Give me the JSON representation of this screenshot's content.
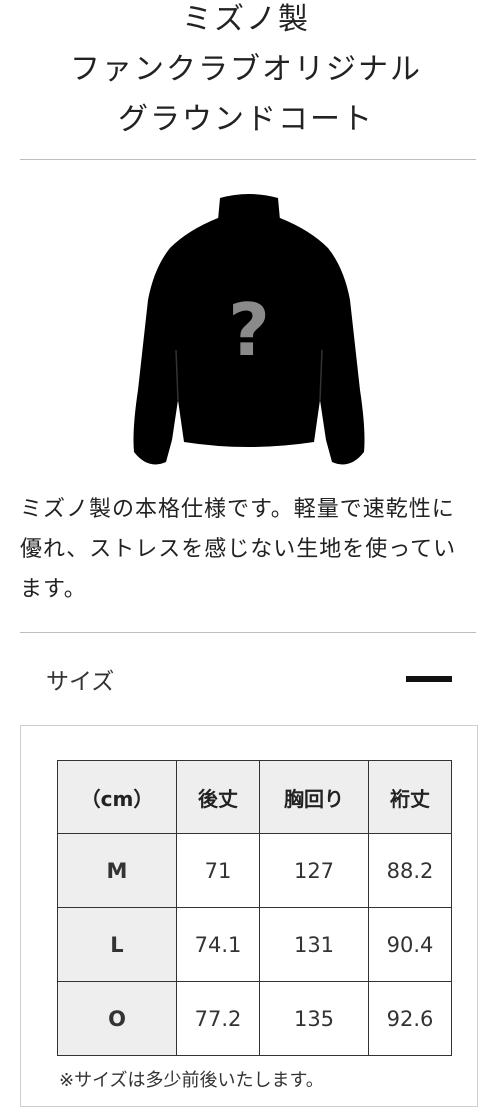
{
  "product": {
    "title_lines": [
      "ミズノ製",
      "ファンクラブオリジナル",
      "グラウンドコート"
    ],
    "image_placeholder": "?",
    "description": "ミズノ製の本格仕様です。軽量で速乾性に優れ、ストレスを感じない生地を使っています。"
  },
  "size_section": {
    "label": "サイズ",
    "toggle_icon": "minus-icon"
  },
  "size_table": {
    "headers": [
      "（cm）",
      "後丈",
      "胸回り",
      "裄丈"
    ],
    "rows": [
      {
        "size": "M",
        "values": [
          "71",
          "127",
          "88.2"
        ]
      },
      {
        "size": "L",
        "values": [
          "74.1",
          "131",
          "90.4"
        ]
      },
      {
        "size": "O",
        "values": [
          "77.2",
          "135",
          "92.6"
        ]
      }
    ],
    "note": "※サイズは多少前後いたします。"
  },
  "colors": {
    "divider": "#bdbdbd",
    "header_bg": "#eeeeee",
    "jacket": "#000000",
    "question_mark": "#8a8a8a"
  }
}
